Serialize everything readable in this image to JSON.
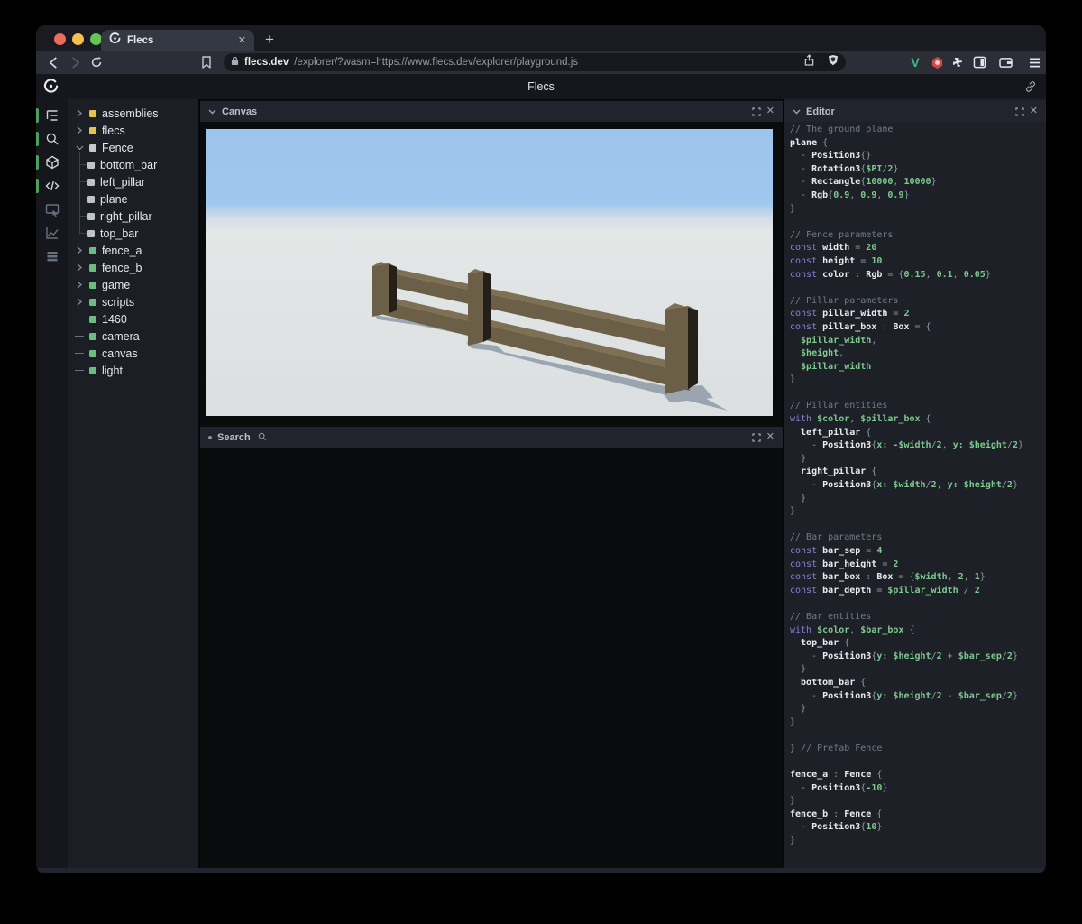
{
  "browser": {
    "tab_title": "Flecs",
    "tab_close": "✕",
    "new_tab_label": "+",
    "url": {
      "domain": "flecs.dev",
      "path": "/explorer/?wasm=https://www.flecs.dev/explorer/playground.js"
    },
    "traffic_lights": {
      "close": "#ed6a5f",
      "minimize": "#f5bf4f",
      "zoom": "#62c554"
    }
  },
  "app": {
    "title": "Flecs"
  },
  "colors": {
    "accent_green": "#4c9e61",
    "code_keyword": "#8780d8",
    "code_green": "#7dc98e",
    "tree_yellow": "#e2c14e",
    "tree_gray": "#c6cad1",
    "tree_childgray": "#bfc4cb",
    "tree_green": "#6cbd80"
  },
  "iconbar": {
    "items": [
      {
        "name": "tree-panel-icon",
        "icon": "tree",
        "active": true
      },
      {
        "name": "search-panel-icon",
        "icon": "search",
        "active": true
      },
      {
        "name": "canvas-panel-icon",
        "icon": "cube",
        "active": true
      },
      {
        "name": "editor-panel-icon",
        "icon": "code",
        "active": true
      },
      {
        "name": "inspector-panel-icon",
        "icon": "inspector",
        "active": false
      },
      {
        "name": "stats-panel-icon",
        "icon": "chart",
        "active": false
      },
      {
        "name": "data-panel-icon",
        "icon": "stack",
        "active": false
      }
    ]
  },
  "tree": {
    "items": [
      {
        "label": "assemblies",
        "square": "tree_yellow",
        "marker": "collapsed"
      },
      {
        "label": "flecs",
        "square": "tree_yellow",
        "marker": "collapsed"
      },
      {
        "label": "Fence",
        "square": "tree_gray",
        "marker": "expanded"
      },
      {
        "label": "bottom_bar",
        "square": "tree_childgray",
        "marker": "child"
      },
      {
        "label": "left_pillar",
        "square": "tree_childgray",
        "marker": "child"
      },
      {
        "label": "plane",
        "square": "tree_childgray",
        "marker": "child"
      },
      {
        "label": "right_pillar",
        "square": "tree_childgray",
        "marker": "child"
      },
      {
        "label": "top_bar",
        "square": "tree_childgray",
        "marker": "child"
      },
      {
        "label": "fence_a",
        "square": "tree_green",
        "marker": "collapsed"
      },
      {
        "label": "fence_b",
        "square": "tree_green",
        "marker": "collapsed"
      },
      {
        "label": "game",
        "square": "tree_green",
        "marker": "collapsed"
      },
      {
        "label": "scripts",
        "square": "tree_green",
        "marker": "collapsed"
      },
      {
        "label": "1460",
        "square": "tree_green",
        "marker": "leaf"
      },
      {
        "label": "camera",
        "square": "tree_green",
        "marker": "leaf"
      },
      {
        "label": "canvas",
        "square": "tree_green",
        "marker": "leaf"
      },
      {
        "label": "light",
        "square": "tree_green",
        "marker": "leaf"
      }
    ]
  },
  "panels": {
    "canvas": {
      "title": "Canvas"
    },
    "search": {
      "title": "Search"
    },
    "editor": {
      "title": "Editor"
    }
  },
  "scene": {
    "sky": "#9dc4ec",
    "ground": "#e3e6e6",
    "wood": "#6c5f47",
    "wood_light": "#7e7054",
    "wood_dark": "#241f18",
    "shadow": "#5a6b81"
  },
  "editor": {
    "lines": [
      [
        [
          "cm",
          "// The ground plane"
        ]
      ],
      [
        [
          "id",
          "plane"
        ],
        [
          "pu",
          " {"
        ]
      ],
      [
        [
          "pu",
          "  - "
        ],
        [
          "id",
          "Position3"
        ],
        [
          "pu",
          "{}"
        ]
      ],
      [
        [
          "pu",
          "  - "
        ],
        [
          "id",
          "Rotation3"
        ],
        [
          "pu",
          "{"
        ],
        [
          "gr",
          "$PI"
        ],
        [
          "pu",
          "/"
        ],
        [
          "gr",
          "2"
        ],
        [
          "pu",
          "}"
        ]
      ],
      [
        [
          "pu",
          "  - "
        ],
        [
          "id",
          "Rectangle"
        ],
        [
          "pu",
          "{"
        ],
        [
          "gr",
          "10000"
        ],
        [
          "pu",
          ", "
        ],
        [
          "gr",
          "10000"
        ],
        [
          "pu",
          "}"
        ]
      ],
      [
        [
          "pu",
          "  - "
        ],
        [
          "id",
          "Rgb"
        ],
        [
          "pu",
          "{"
        ],
        [
          "gr",
          "0.9"
        ],
        [
          "pu",
          ", "
        ],
        [
          "gr",
          "0.9"
        ],
        [
          "pu",
          ", "
        ],
        [
          "gr",
          "0.9"
        ],
        [
          "pu",
          "}"
        ]
      ],
      [
        [
          "pu",
          "}"
        ]
      ],
      [],
      [
        [
          "cm",
          "// Fence parameters"
        ]
      ],
      [
        [
          "kw",
          "const "
        ],
        [
          "id",
          "width"
        ],
        [
          "pu",
          " = "
        ],
        [
          "gr",
          "20"
        ]
      ],
      [
        [
          "kw",
          "const "
        ],
        [
          "id",
          "height"
        ],
        [
          "pu",
          " = "
        ],
        [
          "gr",
          "10"
        ]
      ],
      [
        [
          "kw",
          "const "
        ],
        [
          "id",
          "color"
        ],
        [
          "pu",
          " : "
        ],
        [
          "id",
          "Rgb"
        ],
        [
          "pu",
          " = {"
        ],
        [
          "gr",
          "0.15"
        ],
        [
          "pu",
          ", "
        ],
        [
          "gr",
          "0.1"
        ],
        [
          "pu",
          ", "
        ],
        [
          "gr",
          "0.05"
        ],
        [
          "pu",
          "}"
        ]
      ],
      [],
      [
        [
          "cm",
          "// Pillar parameters"
        ]
      ],
      [
        [
          "kw",
          "const "
        ],
        [
          "id",
          "pillar_width"
        ],
        [
          "pu",
          " = "
        ],
        [
          "gr",
          "2"
        ]
      ],
      [
        [
          "kw",
          "const "
        ],
        [
          "id",
          "pillar_box"
        ],
        [
          "pu",
          " : "
        ],
        [
          "id",
          "Box"
        ],
        [
          "pu",
          " = {"
        ]
      ],
      [
        [
          "gr",
          "  $pillar_width"
        ],
        [
          "pu",
          ","
        ]
      ],
      [
        [
          "gr",
          "  $height"
        ],
        [
          "pu",
          ","
        ]
      ],
      [
        [
          "gr",
          "  $pillar_width"
        ]
      ],
      [
        [
          "pu",
          "}"
        ]
      ],
      [],
      [
        [
          "cm",
          "// Pillar entities"
        ]
      ],
      [
        [
          "kw",
          "with "
        ],
        [
          "gr",
          "$color"
        ],
        [
          "pu",
          ", "
        ],
        [
          "gr",
          "$pillar_box"
        ],
        [
          "pu",
          " {"
        ]
      ],
      [
        [
          "id",
          "  left_pillar"
        ],
        [
          "pu",
          " {"
        ]
      ],
      [
        [
          "pu",
          "    - "
        ],
        [
          "id",
          "Position3"
        ],
        [
          "pu",
          "{"
        ],
        [
          "gr",
          "x:"
        ],
        [
          "pu",
          " "
        ],
        [
          "gr",
          "-$width"
        ],
        [
          "pu",
          "/"
        ],
        [
          "gr",
          "2"
        ],
        [
          "pu",
          ", "
        ],
        [
          "gr",
          "y:"
        ],
        [
          "pu",
          " "
        ],
        [
          "gr",
          "$height"
        ],
        [
          "pu",
          "/"
        ],
        [
          "gr",
          "2"
        ],
        [
          "pu",
          "}"
        ]
      ],
      [
        [
          "pu",
          "  }"
        ]
      ],
      [
        [
          "id",
          "  right_pillar"
        ],
        [
          "pu",
          " {"
        ]
      ],
      [
        [
          "pu",
          "    - "
        ],
        [
          "id",
          "Position3"
        ],
        [
          "pu",
          "{"
        ],
        [
          "gr",
          "x:"
        ],
        [
          "pu",
          " "
        ],
        [
          "gr",
          "$width"
        ],
        [
          "pu",
          "/"
        ],
        [
          "gr",
          "2"
        ],
        [
          "pu",
          ", "
        ],
        [
          "gr",
          "y:"
        ],
        [
          "pu",
          " "
        ],
        [
          "gr",
          "$height"
        ],
        [
          "pu",
          "/"
        ],
        [
          "gr",
          "2"
        ],
        [
          "pu",
          "}"
        ]
      ],
      [
        [
          "pu",
          "  }"
        ]
      ],
      [
        [
          "pu",
          "}"
        ]
      ],
      [],
      [
        [
          "cm",
          "// Bar parameters"
        ]
      ],
      [
        [
          "kw",
          "const "
        ],
        [
          "id",
          "bar_sep"
        ],
        [
          "pu",
          " = "
        ],
        [
          "gr",
          "4"
        ]
      ],
      [
        [
          "kw",
          "const "
        ],
        [
          "id",
          "bar_height"
        ],
        [
          "pu",
          " = "
        ],
        [
          "gr",
          "2"
        ]
      ],
      [
        [
          "kw",
          "const "
        ],
        [
          "id",
          "bar_box"
        ],
        [
          "pu",
          " : "
        ],
        [
          "id",
          "Box"
        ],
        [
          "pu",
          " = {"
        ],
        [
          "gr",
          "$width"
        ],
        [
          "pu",
          ", "
        ],
        [
          "gr",
          "2"
        ],
        [
          "pu",
          ", "
        ],
        [
          "gr",
          "1"
        ],
        [
          "pu",
          "}"
        ]
      ],
      [
        [
          "kw",
          "const "
        ],
        [
          "id",
          "bar_depth"
        ],
        [
          "pu",
          " = "
        ],
        [
          "gr",
          "$pillar_width"
        ],
        [
          "pu",
          " / "
        ],
        [
          "gr",
          "2"
        ]
      ],
      [],
      [
        [
          "cm",
          "// Bar entities"
        ]
      ],
      [
        [
          "kw",
          "with "
        ],
        [
          "gr",
          "$color"
        ],
        [
          "pu",
          ", "
        ],
        [
          "gr",
          "$bar_box"
        ],
        [
          "pu",
          " {"
        ]
      ],
      [
        [
          "id",
          "  top_bar"
        ],
        [
          "pu",
          " {"
        ]
      ],
      [
        [
          "pu",
          "    - "
        ],
        [
          "id",
          "Position3"
        ],
        [
          "pu",
          "{"
        ],
        [
          "gr",
          "y:"
        ],
        [
          "pu",
          " "
        ],
        [
          "gr",
          "$height"
        ],
        [
          "pu",
          "/"
        ],
        [
          "gr",
          "2"
        ],
        [
          "pu",
          " + "
        ],
        [
          "gr",
          "$bar_sep"
        ],
        [
          "pu",
          "/"
        ],
        [
          "gr",
          "2"
        ],
        [
          "pu",
          "}"
        ]
      ],
      [
        [
          "pu",
          "  }"
        ]
      ],
      [
        [
          "id",
          "  bottom_bar"
        ],
        [
          "pu",
          " {"
        ]
      ],
      [
        [
          "pu",
          "    - "
        ],
        [
          "id",
          "Position3"
        ],
        [
          "pu",
          "{"
        ],
        [
          "gr",
          "y:"
        ],
        [
          "pu",
          " "
        ],
        [
          "gr",
          "$height"
        ],
        [
          "pu",
          "/"
        ],
        [
          "gr",
          "2"
        ],
        [
          "pu",
          " - "
        ],
        [
          "gr",
          "$bar_sep"
        ],
        [
          "pu",
          "/"
        ],
        [
          "gr",
          "2"
        ],
        [
          "pu",
          "}"
        ]
      ],
      [
        [
          "pu",
          "  }"
        ]
      ],
      [
        [
          "pu",
          "}"
        ]
      ],
      [],
      [
        [
          "pu",
          "} "
        ],
        [
          "cm",
          "// Prefab Fence"
        ]
      ],
      [],
      [
        [
          "id",
          "fence_a"
        ],
        [
          "pu",
          " : "
        ],
        [
          "id",
          "Fence"
        ],
        [
          "pu",
          " {"
        ]
      ],
      [
        [
          "pu",
          "  - "
        ],
        [
          "id",
          "Position3"
        ],
        [
          "pu",
          "{"
        ],
        [
          "gr",
          "-10"
        ],
        [
          "pu",
          "}"
        ]
      ],
      [
        [
          "pu",
          "}"
        ]
      ],
      [
        [
          "id",
          "fence_b"
        ],
        [
          "pu",
          " : "
        ],
        [
          "id",
          "Fence"
        ],
        [
          "pu",
          " {"
        ]
      ],
      [
        [
          "pu",
          "  - "
        ],
        [
          "id",
          "Position3"
        ],
        [
          "pu",
          "{"
        ],
        [
          "gr",
          "10"
        ],
        [
          "pu",
          "}"
        ]
      ],
      [
        [
          "pu",
          "}"
        ]
      ]
    ]
  }
}
